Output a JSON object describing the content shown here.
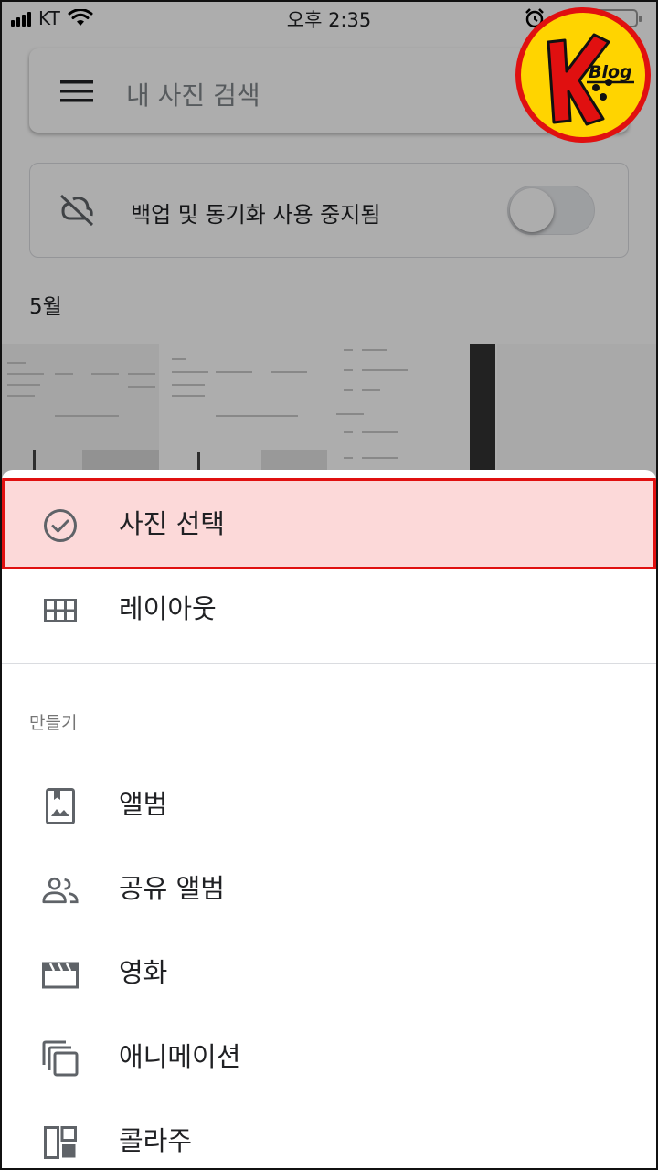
{
  "status_bar": {
    "carrier": "KT",
    "time": "오후 2:35"
  },
  "search": {
    "placeholder": "내 사진 검색",
    "menu_icon": "menu-icon"
  },
  "backup": {
    "text": "백업 및 동기화 사용 중지됨",
    "icon": "cloud-off-icon",
    "toggle_on": false
  },
  "grid": {
    "month_label": "5월"
  },
  "logo": {
    "letter": "K",
    "text": "Blog"
  },
  "sheet": {
    "items": [
      {
        "label": "사진 선택",
        "icon": "check-circle-icon",
        "highlighted": true
      },
      {
        "label": "레이아웃",
        "icon": "grid-layout-icon"
      }
    ],
    "create_section": {
      "title": "만들기",
      "items": [
        {
          "label": "앨범",
          "icon": "album-icon"
        },
        {
          "label": "공유 앨범",
          "icon": "people-icon"
        },
        {
          "label": "영화",
          "icon": "movie-icon"
        },
        {
          "label": "애니메이션",
          "icon": "animation-icon"
        },
        {
          "label": "콜라주",
          "icon": "collage-icon"
        }
      ]
    }
  },
  "colors": {
    "highlight_fill": "#fcd9d9",
    "highlight_border": "#e01010",
    "logo_yellow": "#ffd400",
    "logo_red": "#e01010"
  }
}
